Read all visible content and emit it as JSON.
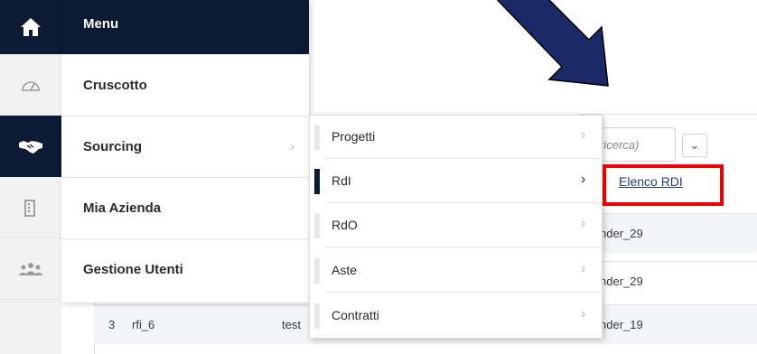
{
  "menu": {
    "header": "Menu",
    "items": [
      {
        "label": "Cruscotto",
        "icon": "gauge-icon"
      },
      {
        "label": "Sourcing",
        "icon": "handshake-icon",
        "chevron": "›"
      },
      {
        "label": "Mia Azienda",
        "icon": "building-icon"
      },
      {
        "label": "Gestione Utenti",
        "icon": "users-icon"
      }
    ]
  },
  "submenu": {
    "items": [
      {
        "label": "Progetti",
        "chevron": "›"
      },
      {
        "label": "RdI",
        "chevron": "›"
      },
      {
        "label": "RdO",
        "chevron": "›"
      },
      {
        "label": "Aste",
        "chevron": "›"
      },
      {
        "label": "Contratti",
        "chevron": "›"
      }
    ]
  },
  "third_menu": {
    "link": "Elenco RDI"
  },
  "search": {
    "placeholder": "ricerca)",
    "dropdown": "⌄"
  },
  "table": {
    "rows": [
      {
        "num": "",
        "code": "",
        "desc": "",
        "owner": "nder_29"
      },
      {
        "num": "",
        "code": "",
        "desc": "",
        "owner": "nder_29"
      },
      {
        "num": "3",
        "code": "rfi_6",
        "desc": "test",
        "owner": "nder_19"
      }
    ]
  },
  "colors": {
    "navy": "#0d1a33",
    "highlight": "#ee0000",
    "arrow": "#1b2a66"
  }
}
